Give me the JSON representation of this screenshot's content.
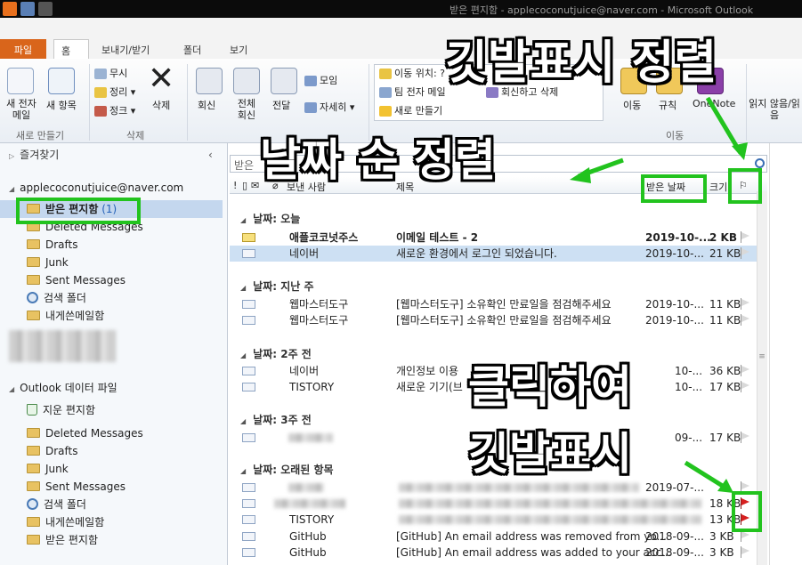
{
  "window": {
    "title": "받은 편지함 - applecoconutjuice@naver.com - Microsoft Outlook"
  },
  "ribbon_tabs": [
    "파일",
    "홈",
    "보내기/받기",
    "폴더",
    "보기"
  ],
  "ribbon": {
    "new_email": "새 전자 메일",
    "new_items": "새 항목",
    "new_group": "새로 만들기",
    "ignore": "무시",
    "cleanup": "정리",
    "junk": "정크",
    "delete": "삭제",
    "delete_group": "삭제",
    "reply": "회신",
    "reply_all": "전체 회신",
    "forward": "전달",
    "meeting": "모임",
    "more": "자세히",
    "move_to": "이동 위치: ?",
    "team_email": "팀 전자 메일",
    "new_quick": "새로 만들기",
    "reply_delete": "회신하고 삭제",
    "move": "이동",
    "rules": "규칙",
    "onenote": "OneNote",
    "move_group": "이동",
    "unread": "읽지 않음/읽음"
  },
  "nav": {
    "favorites": "즐겨찾기",
    "account": "applecoconutjuice@naver.com",
    "inbox": "받은 편지함",
    "inbox_count": "(1)",
    "folders": [
      "Deleted Messages",
      "Drafts",
      "Junk",
      "Sent Messages",
      "검색 폴더",
      "내게쓴메일함"
    ],
    "datafile": "Outlook 데이터 파일",
    "deleted_items": "지운 편지함",
    "datafile_folders": [
      "Deleted Messages",
      "Drafts",
      "Junk",
      "Sent Messages",
      "검색 폴더",
      "내게쓴메일함",
      "받은 편지함"
    ]
  },
  "list": {
    "search_placeholder": "받은",
    "columns": {
      "from": "보낸 사람",
      "subject": "제목",
      "received": "받은 날짜",
      "size": "크기"
    },
    "groups": [
      {
        "label": "날짜: 오늘"
      },
      {
        "label": "날짜: 지난 주"
      },
      {
        "label": "날짜: 2주 전"
      },
      {
        "label": "날짜: 3주 전"
      },
      {
        "label": "날짜: 오래된 항목"
      }
    ],
    "messages": [
      {
        "from": "애플코코넛주스",
        "subject": "이메일 테스트 - 2",
        "date": "2019-10-...",
        "size": "2 KB",
        "unread": true
      },
      {
        "from": "네이버",
        "subject": "새로운 환경에서 로그인 되었습니다.",
        "date": "2019-10-...",
        "size": "21 KB"
      },
      {
        "from": "웹마스터도구",
        "subject": "[웹마스터도구] 소유확인 만료일을 점검해주세요",
        "date": "2019-10-...",
        "size": "11 KB"
      },
      {
        "from": "웹마스터도구",
        "subject": "[웹마스터도구] 소유확인 만료일을 점검해주세요",
        "date": "2019-10-...",
        "size": "11 KB"
      },
      {
        "from": "네이버",
        "subject": "개인정보 이용",
        "date": "10-...",
        "size": "36 KB"
      },
      {
        "from": "TISTORY",
        "subject": "새로운 기기(브",
        "date": "10-...",
        "size": "17 KB"
      },
      {
        "from": "",
        "subject": "",
        "date": "09-...",
        "size": "17 KB"
      },
      {
        "from": "",
        "subject": "",
        "date": "2019-07-...",
        "size": ""
      },
      {
        "from": "",
        "subject": "",
        "date": "",
        "size": "18 KB",
        "flag": true
      },
      {
        "from": "TISTORY",
        "subject": "",
        "date": "",
        "size": "13 KB",
        "flag": true
      },
      {
        "from": "GitHub",
        "subject": "[GitHub] An email address was removed from yo...",
        "date": "2018-09-...",
        "size": "3 KB"
      },
      {
        "from": "GitHub",
        "subject": "[GitHub] An email address was added to your acc...",
        "date": "2018-09-...",
        "size": "3 KB"
      }
    ]
  },
  "annotations": {
    "flag_sort": "깃발표시 정렬",
    "date_sort": "날짜 순 정렬",
    "click_flag_1": "클릭하여",
    "click_flag_2": "깃발표시"
  },
  "colors": {
    "highlight": "#22c31e",
    "file_tab": "#d9651b",
    "flag": "#d72020"
  }
}
